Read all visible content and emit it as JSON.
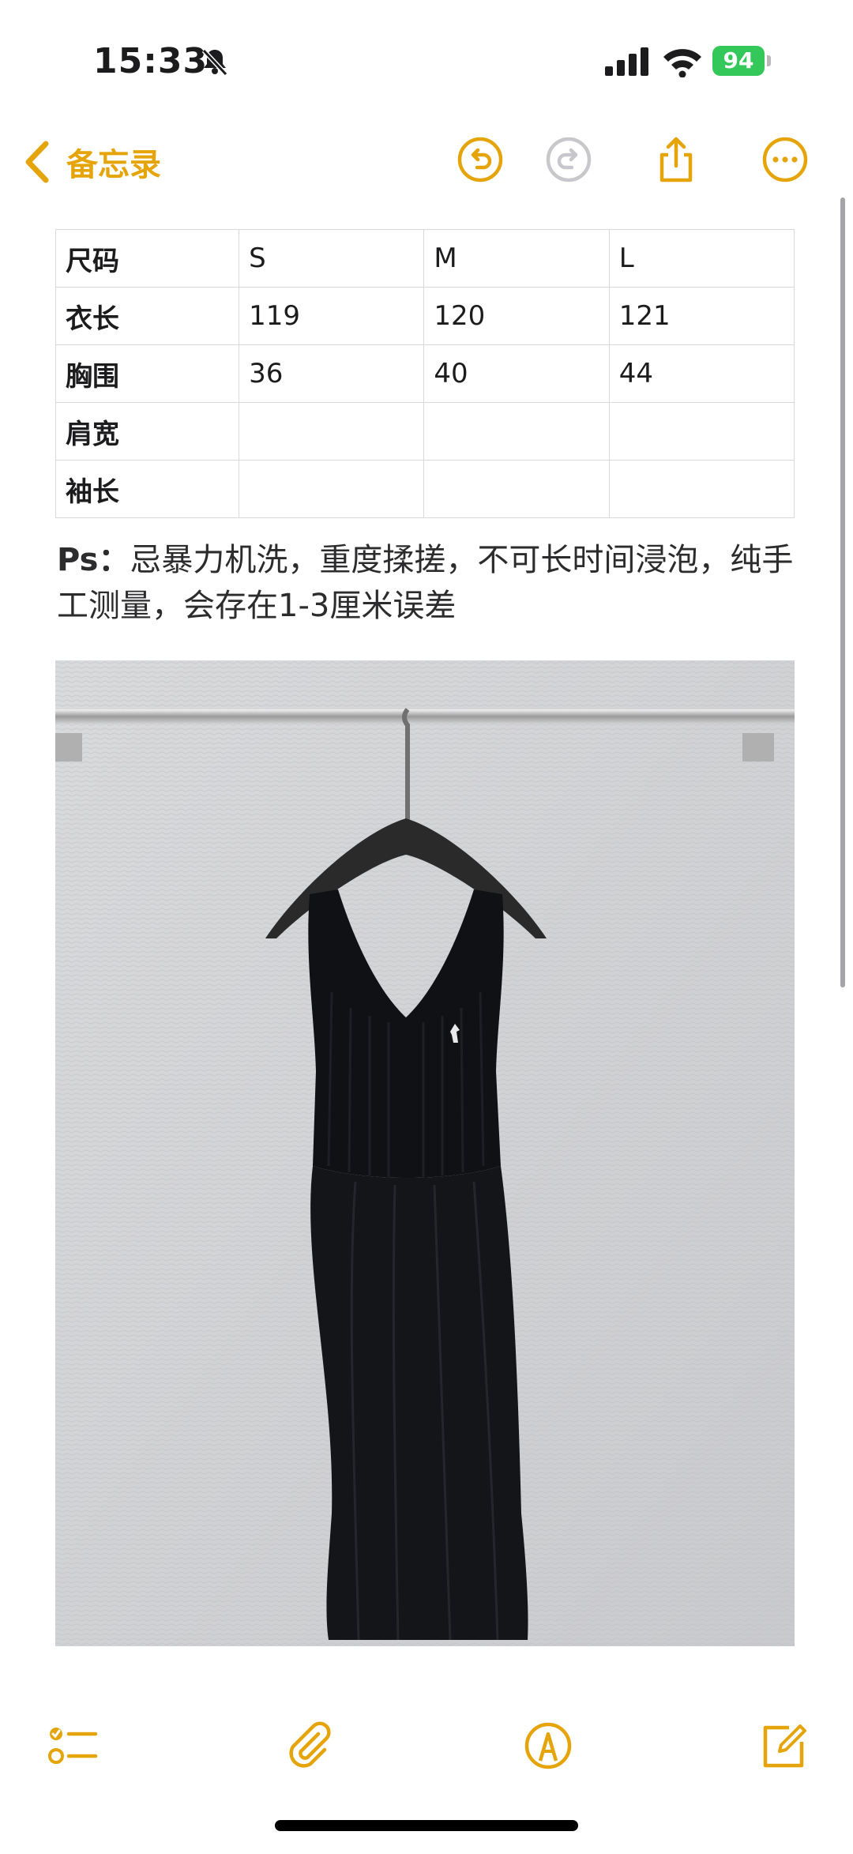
{
  "status": {
    "time": "15:33",
    "battery": "94"
  },
  "nav": {
    "back_label": "备忘录"
  },
  "table": {
    "rows": [
      [
        "尺码",
        "S",
        "M",
        "L"
      ],
      [
        "衣长",
        "119",
        "120",
        "121"
      ],
      [
        "胸围",
        "36",
        "40",
        "44"
      ],
      [
        "肩宽",
        "",
        "",
        ""
      ],
      [
        "袖长",
        "",
        "",
        ""
      ]
    ]
  },
  "note": {
    "ps_label": "Ps：",
    "text": "忌暴力机洗，重度揉搓，不可长时间浸泡，纯手工测量，会存在1-3厘米误差"
  },
  "colors": {
    "accent": "#e5a50a",
    "battery": "#34c759"
  },
  "icons": [
    "chevron-left-icon",
    "undo-icon",
    "redo-icon",
    "share-icon",
    "more-icon",
    "checklist-icon",
    "attachment-icon",
    "markup-icon",
    "compose-icon"
  ]
}
